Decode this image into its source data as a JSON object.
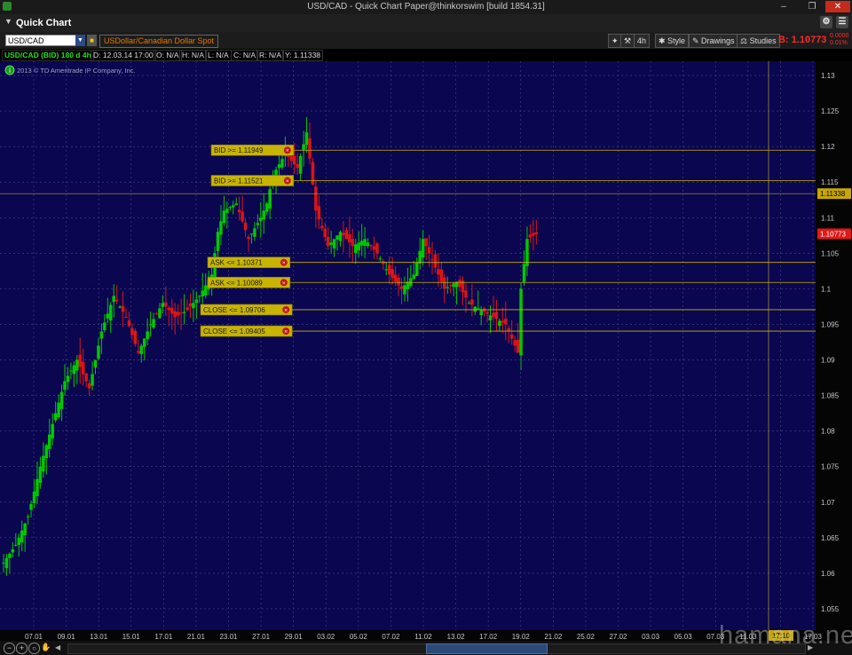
{
  "window": {
    "title": "USD/CAD - Quick Chart Paper@thinkorswim [build 1854.31]"
  },
  "header": {
    "title": "Quick Chart"
  },
  "toolbar": {
    "symbol": "USD/CAD",
    "description": "USDollar/Canadian Dollar Spot",
    "aggregation": "4h",
    "style_label": "Style",
    "drawings_label": "Drawings",
    "studies_label": "Studies",
    "bid_label": "B: 1.10773",
    "change_top": "0.0000",
    "change_bottom": "0.01%"
  },
  "infobar": {
    "study": "USD/CAD (BID) 180 d 4h",
    "date": "D: 12.03.14 17:00",
    "open": "O: N/A",
    "high": "H: N/A",
    "low": "L: N/A",
    "close": "C: N/A",
    "range": "R: N/A",
    "y": "Y: 1.11338"
  },
  "copyright": "2013 © TD Ameritrade IP Company, Inc.",
  "watermark": "hamana.net",
  "colors": {
    "background": "#0a0650",
    "up": "#00c800",
    "down": "#dc1414",
    "alert": "#c8b400",
    "grid": "#4a4a80"
  },
  "chart_data": {
    "type": "candlestick",
    "ylim": [
      1.052,
      1.132
    ],
    "y_ticks": [
      "1.13",
      "1.125",
      "1.12",
      "1.115",
      "1.11",
      "1.105",
      "1.1",
      "1.095",
      "1.09",
      "1.085",
      "1.08",
      "1.075",
      "1.07",
      "1.065",
      "1.06",
      "1.055"
    ],
    "x_ticks": [
      "07.01",
      "09.01",
      "13.01",
      "15.01",
      "17.01",
      "21.01",
      "23.01",
      "27.01",
      "29.01",
      "03.02",
      "05.02",
      "07.02",
      "11.02",
      "13.02",
      "17.02",
      "19.02",
      "21.02",
      "25.02",
      "27.02",
      "03.03",
      "05.03",
      "07.03",
      "11.03",
      "13.03",
      "17.03"
    ],
    "time_marker": "17:10",
    "price_marker_last": "1.10773",
    "price_marker_cursor": "1.11338",
    "last_price": 1.10773,
    "cursor_price": 1.11338,
    "alerts": [
      {
        "label": "BID >= 1.11949",
        "price": 1.11949
      },
      {
        "label": "BID >= 1.11521",
        "price": 1.11521
      },
      {
        "label": "ASK <= 1.10371",
        "price": 1.10371
      },
      {
        "label": "ASK <= 1.10089",
        "price": 1.10089
      },
      {
        "label": "CLOSE <= 1.09706",
        "price": 1.09706
      },
      {
        "label": "CLOSE <= 1.09405",
        "price": 1.09405
      }
    ],
    "path": [
      [
        0,
        1.0615
      ],
      [
        4,
        1.064
      ],
      [
        8,
        1.068
      ],
      [
        12,
        1.075
      ],
      [
        16,
        1.081
      ],
      [
        20,
        1.087
      ],
      [
        24,
        1.09
      ],
      [
        28,
        1.086
      ],
      [
        32,
        1.094
      ],
      [
        36,
        1.099
      ],
      [
        40,
        1.096
      ],
      [
        44,
        1.091
      ],
      [
        48,
        1.095
      ],
      [
        52,
        1.098
      ],
      [
        56,
        1.096
      ],
      [
        60,
        1.097
      ],
      [
        64,
        1.099
      ],
      [
        68,
        1.102
      ],
      [
        70,
        1.108
      ],
      [
        72,
        1.111
      ],
      [
        76,
        1.112
      ],
      [
        80,
        1.107
      ],
      [
        84,
        1.11
      ],
      [
        86,
        1.112
      ],
      [
        88,
        1.116
      ],
      [
        92,
        1.119
      ],
      [
        96,
        1.117
      ],
      [
        99,
        1.122
      ],
      [
        102,
        1.111
      ],
      [
        106,
        1.106
      ],
      [
        110,
        1.108
      ],
      [
        114,
        1.106
      ],
      [
        118,
        1.107
      ],
      [
        122,
        1.105
      ],
      [
        126,
        1.102
      ],
      [
        130,
        1.1
      ],
      [
        134,
        1.102
      ],
      [
        137,
        1.107
      ],
      [
        140,
        1.104
      ],
      [
        144,
        1.1
      ],
      [
        148,
        1.101
      ],
      [
        152,
        1.098
      ],
      [
        156,
        1.097
      ],
      [
        160,
        1.096
      ],
      [
        164,
        1.095
      ],
      [
        166,
        1.093
      ],
      [
        168,
        1.091
      ],
      [
        169,
        1.1
      ],
      [
        171,
        1.107
      ],
      [
        174,
        1.1077
      ]
    ]
  }
}
